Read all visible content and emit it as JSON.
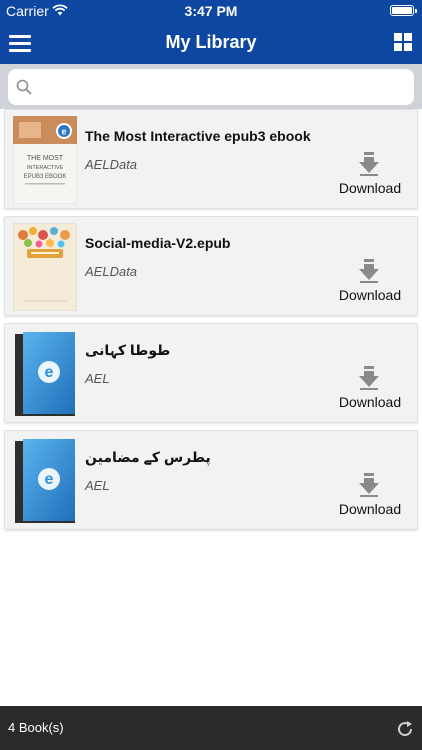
{
  "status_bar": {
    "carrier": "Carrier",
    "time": "3:47 PM"
  },
  "nav": {
    "title": "My Library",
    "menu_icon": "hamburger-icon",
    "view_icon": "grid-icon"
  },
  "search": {
    "placeholder": "",
    "value": ""
  },
  "books": [
    {
      "title": "The Most Interactive epub3 ebook",
      "author": "AELData",
      "action": "Download",
      "cover": "interactive-epub3-cover"
    },
    {
      "title": "Social-media-V2.epub",
      "author": "AELData",
      "action": "Download",
      "cover": "social-media-cover"
    },
    {
      "title": "طوطا کہانی",
      "author": "AEL",
      "action": "Download",
      "cover": "blue-e-book-cover"
    },
    {
      "title": "پطرس کے مضامین",
      "author": "AEL",
      "action": "Download",
      "cover": "blue-e-book-cover"
    }
  ],
  "footer": {
    "count": "4 Book(s)",
    "refresh_icon": "refresh-icon"
  },
  "colors": {
    "nav_bg": "#0d47a1",
    "footer_bg": "#2b2b2b",
    "card_bg": "#f2f2f2"
  },
  "cover_text": {
    "line1": "THE MOST",
    "line2": "INTERACTIVE",
    "line3": "EPUB3 EBOOK"
  }
}
